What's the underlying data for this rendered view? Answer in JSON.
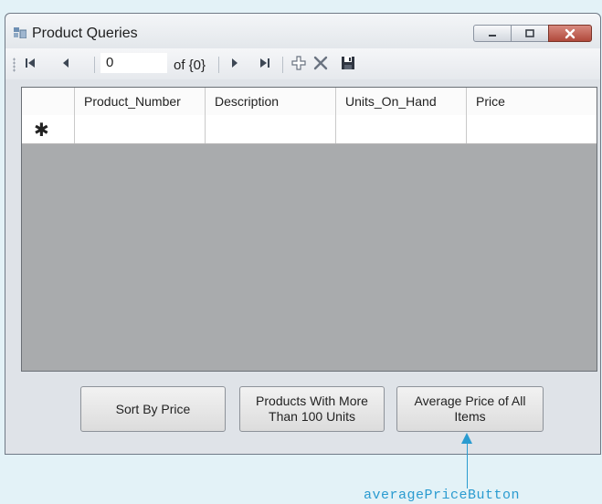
{
  "window": {
    "title": "Product Queries",
    "icon": "form-icon",
    "controls": [
      "minimize-icon",
      "maximize-icon",
      "close-icon"
    ]
  },
  "navigator": {
    "position": "0",
    "count_label": "of {0}",
    "icons": [
      "move-first-icon",
      "move-previous-icon",
      "move-next-icon",
      "move-last-icon",
      "add-new-icon",
      "delete-icon",
      "save-icon"
    ]
  },
  "grid": {
    "columns": [
      "Product_Number",
      "Description",
      "Units_On_Hand",
      "Price"
    ],
    "new_row_marker": "✱",
    "background": "#a9abad"
  },
  "buttons": {
    "sort_by_price": "Sort By Price",
    "more_than_100": "Products With More Than 100 Units",
    "average_price": "Average Price of All Items"
  },
  "callout": {
    "label": "averagePriceButton",
    "color": "#2a9bd0"
  }
}
